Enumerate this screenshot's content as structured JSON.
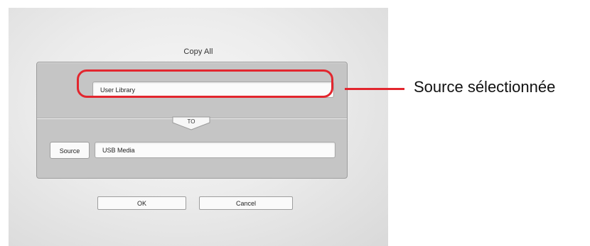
{
  "dialog": {
    "title": "Copy All",
    "source_value": "User Library",
    "to_label": "TO",
    "source_button": "Source",
    "destination_value": "USB Media",
    "ok_label": "OK",
    "cancel_label": "Cancel"
  },
  "annotation": {
    "label": "Source sélectionnée",
    "color": "#e2262e"
  }
}
